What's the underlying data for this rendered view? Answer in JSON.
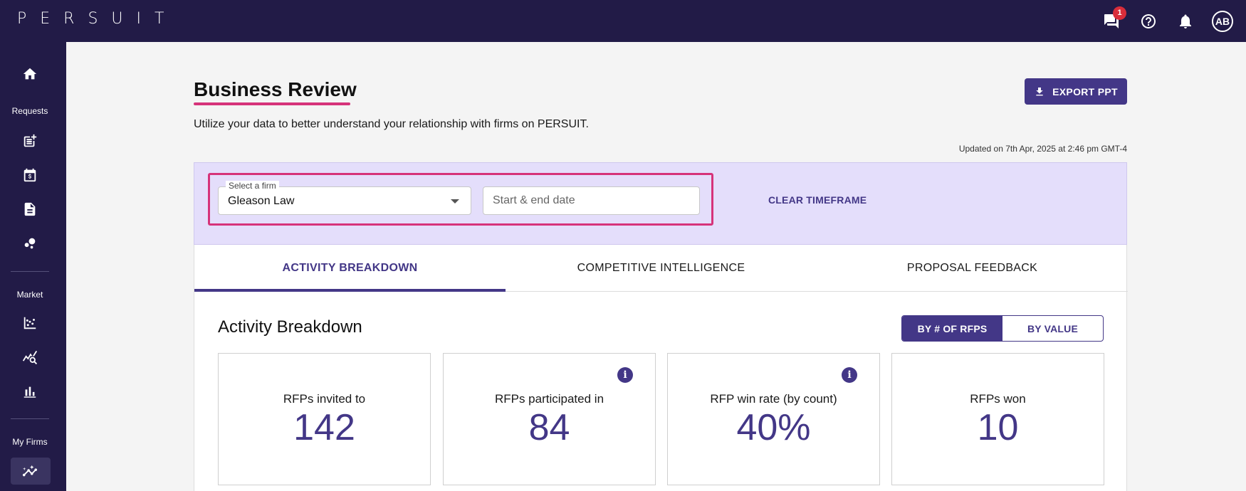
{
  "header": {
    "logo": "PERSUIT",
    "chat_badge_count": "1",
    "avatar_initials": "AB"
  },
  "sidebar": {
    "section_requests": "Requests",
    "section_market": "Market",
    "section_my_firms": "My Firms"
  },
  "page": {
    "title": "Business Review",
    "subtitle": "Utilize your data to better understand your relationship with firms on PERSUIT.",
    "export_label": "EXPORT PPT",
    "updated": "Updated on 7th Apr, 2025 at 2:46 pm GMT-4"
  },
  "filters": {
    "firm_legend": "Select a firm",
    "firm_value": "Gleason  Law",
    "date_placeholder": "Start & end date",
    "clear_label": "CLEAR TIMEFRAME"
  },
  "tabs": [
    {
      "label": "ACTIVITY BREAKDOWN",
      "active": true
    },
    {
      "label": "COMPETITIVE INTELLIGENCE",
      "active": false
    },
    {
      "label": "PROPOSAL FEEDBACK",
      "active": false
    }
  ],
  "activity": {
    "title": "Activity Breakdown",
    "toggle": [
      "BY # OF RFPS",
      "BY VALUE"
    ],
    "stats": [
      {
        "label": "RFPs invited to",
        "value": "142"
      },
      {
        "label": "RFPs participated in",
        "value": "84"
      },
      {
        "label": "RFP win rate (by count)",
        "value": "40%"
      },
      {
        "label": "RFPs won",
        "value": "10"
      }
    ]
  },
  "colors": {
    "nav": "#221b47",
    "accent": "#433787",
    "highlight": "#d6337a",
    "filter_bg": "#e4defb"
  }
}
